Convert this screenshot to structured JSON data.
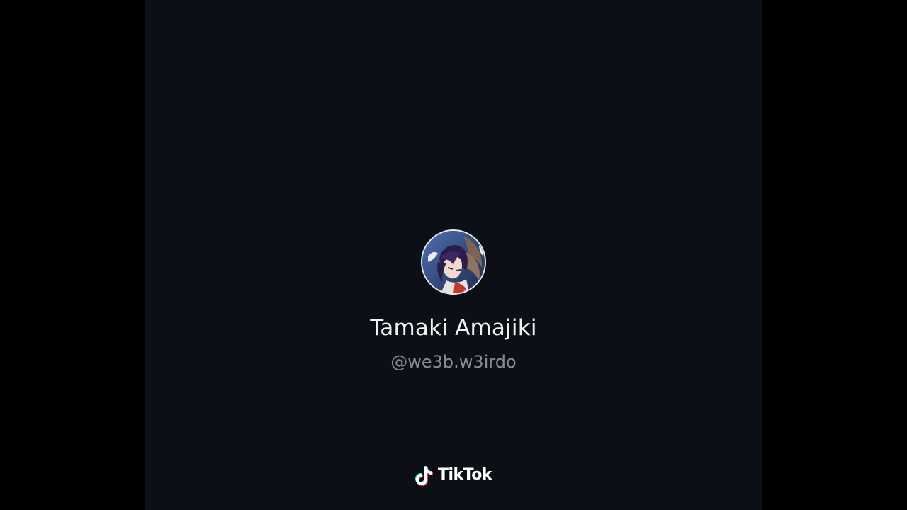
{
  "profile": {
    "display_name": "Tamaki Amajiki",
    "handle": "@we3b.w3irdo",
    "avatar_icon": "anime-character-avatar"
  },
  "watermark": {
    "brand_name": "TikTok",
    "logo_icon": "tiktok-note-icon"
  },
  "colors": {
    "frame_background": "#0d0f16",
    "letterbox": "#000000",
    "name_text": "#f2f2f4",
    "handle_text": "#8a8b90",
    "logo_cyan": "#25f4ee",
    "logo_red": "#fe2c55"
  }
}
